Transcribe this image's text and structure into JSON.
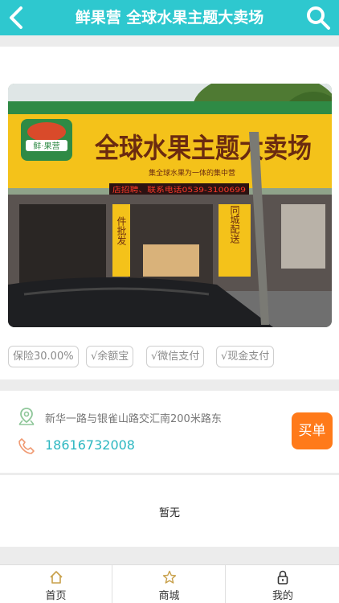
{
  "header": {
    "title": "鲜果营 全球水果主题大卖场",
    "back_icon": "back-arrow-icon",
    "search_icon": "search-icon",
    "color": "#2ec8cf"
  },
  "store_photo": {
    "logo_text": "鲜·果营",
    "sign_text": "全球水果主题大卖场",
    "sub_sign": "集全球水果为一体的集中营",
    "led_text": "店招聘、联系电话0539-3100699",
    "window_text_1": "同城配送",
    "window_text_2": "件批发"
  },
  "tags": [
    "保险30.00%",
    "√余额宝",
    "√微信支付",
    "√现金支付"
  ],
  "contact": {
    "address": "新华一路与银雀山路交汇南200米路东",
    "phone": "18616732008",
    "buy_label": "买单",
    "accent": "#ff7a1a",
    "phone_color": "#2cb7c1"
  },
  "reviews": {
    "empty_text": "暂无"
  },
  "tabbar": {
    "items": [
      {
        "label": "首页",
        "icon": "home-icon"
      },
      {
        "label": "商城",
        "icon": "star-icon"
      },
      {
        "label": "我的",
        "icon": "lock-icon"
      }
    ],
    "active_color": "#c8a04a"
  }
}
